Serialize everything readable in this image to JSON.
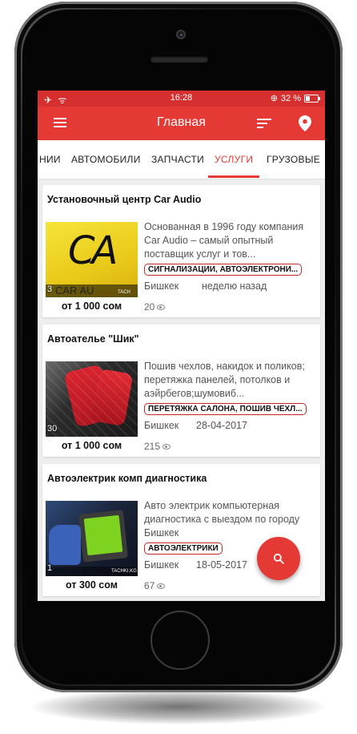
{
  "status_bar": {
    "time": "16:28",
    "battery": "32 %",
    "left_icons": "✈ ᯤ"
  },
  "app_bar": {
    "title": "Главная",
    "menu_icon": "menu-icon",
    "sort_icon": "sort-icon",
    "location_icon": "location-pin-icon"
  },
  "tabs": [
    {
      "label": "НИИ"
    },
    {
      "label": "АВТОМОБИЛИ"
    },
    {
      "label": "ЗАПЧАСТИ"
    },
    {
      "label": "УСЛУГИ",
      "active": true
    },
    {
      "label": "ГРУЗОВЫЕ"
    }
  ],
  "listings": [
    {
      "title": "Установочный центр Car Audio",
      "description": "Основанная в 1996 году компания Car Audio – самый опытный поставщик услуг и тов...",
      "tag": "СИГНАЛИЗАЦИИ, АВТОЭЛЕКТРОНИ...",
      "city": "Бишкек",
      "date": "неделю назад",
      "views": "20",
      "price": "от 1 000 сом",
      "photo_count": "3",
      "logo_text": "CA",
      "watermark": "CAR AU",
      "watermark_small": "TACH"
    },
    {
      "title": "Автоателье \"Шик\"",
      "description": "Пошив чехлов, накидок и поликов; перетяжка панелей, потолков и аэйрбегов;шумовиб...",
      "tag": "ПЕРЕТЯЖКА САЛОНА, ПОШИВ ЧЕХЛ...",
      "city": "Бишкек",
      "date": "28-04-2017",
      "views": "215",
      "price": "от 1 000 сом",
      "photo_count": "30"
    },
    {
      "title": "Автоэлектрик комп диагностика",
      "description": "Авто электрик компьютерная диагностика с выездом по городу Бишкек",
      "tag": "АВТОЭЛЕКТРИКИ",
      "city": "Бишкек",
      "date": "18-05-2017",
      "views": "67",
      "price": "от 300 сом",
      "photo_count": "1",
      "watermark_small": "TACHKI.KG"
    }
  ],
  "fab": {
    "icon": "search-icon"
  },
  "colors": {
    "primary": "#e53935",
    "status_bar": "#d62f2f",
    "tag_border": "#c62828"
  }
}
